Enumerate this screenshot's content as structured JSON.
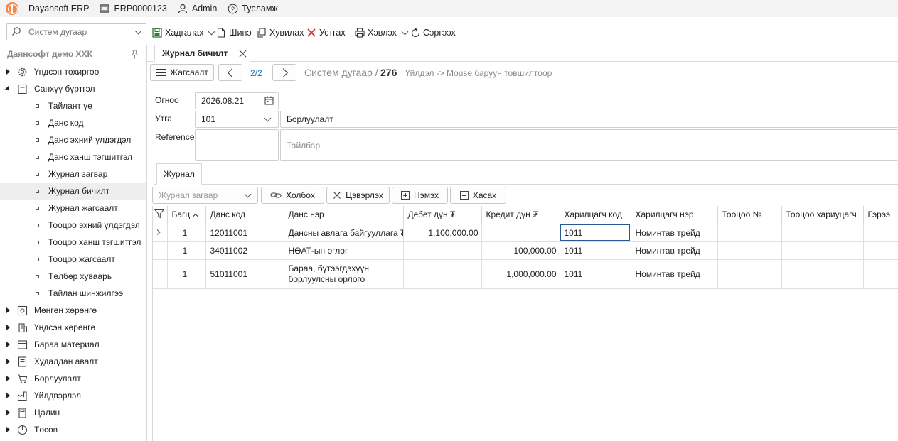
{
  "titlebar": {
    "app_name": "Dayansoft ERP",
    "db_name": "ERP0000123",
    "user": "Admin",
    "help": "Тусламж"
  },
  "toolbar": {
    "search_placeholder": "Систем дугаар",
    "save": "Хадгалах",
    "new": "Шинэ",
    "copy": "Хувилах",
    "delete": "Устгах",
    "print": "Хэвлэх",
    "refresh": "Сэргээх"
  },
  "sidebar": {
    "company": "Даянсофт демо ХХК",
    "items": [
      {
        "label": "Үндсэн тохиргоо",
        "icon": "gear-icon",
        "expanded": false
      },
      {
        "label": "Санхүү бүртгэл",
        "icon": "book-icon",
        "expanded": true
      }
    ],
    "subitems": [
      "Тайлант үе",
      "Данс код",
      "Данс эхний үлдэгдэл",
      "Данс ханш тэгшитгэл",
      "Журнал загвар",
      "Журнал бичилт",
      "Журнал жагсаалт",
      "Тооцоо эхний үлдэгдэл",
      "Тооцоо ханш тэгшитгэл",
      "Тооцоо жагсаалт",
      "Төлбөр хуваарь",
      "Тайлан шинжилгээ"
    ],
    "selected_subitem": "Журнал бичилт",
    "modules": [
      {
        "label": "Мөнгөн хөрөнгө",
        "icon": "safe-icon"
      },
      {
        "label": "Үндсэн хөрөнгө",
        "icon": "building-icon"
      },
      {
        "label": "Бараа материал",
        "icon": "box-icon"
      },
      {
        "label": "Худалдан авалт",
        "icon": "document-icon"
      },
      {
        "label": "Борлуулалт",
        "icon": "cart-icon"
      },
      {
        "label": "Үйлдвэрлэл",
        "icon": "factory-icon"
      },
      {
        "label": "Цалин",
        "icon": "calculator-icon"
      },
      {
        "label": "Төсөв",
        "icon": "pie-chart-icon"
      }
    ]
  },
  "document_tab": {
    "title": "Журнал бичилт"
  },
  "nav": {
    "list_button": "Жагсаалт",
    "page_indicator": "2/2",
    "system_number_label": "Систем дугаар /",
    "system_number": "276",
    "hint": "Үйлдэл -> Mouse баруун товшилтоор"
  },
  "form": {
    "date_label": "Огноо",
    "date_value": "2026.08.21",
    "code_label": "Утга",
    "code_value": "101",
    "code_description": "Борлуулалт",
    "reference_label": "Reference",
    "reference_value": "",
    "note_placeholder": "Тайлбар"
  },
  "subtabs": [
    "Журнал"
  ],
  "grid_toolbar": {
    "template_placeholder": "Журнал загвар",
    "link": "Холбох",
    "clear": "Цэвэрлэх",
    "add": "Нэмэх",
    "remove": "Хасах"
  },
  "grid": {
    "columns": [
      "Багц",
      "Данс код",
      "Данс нэр",
      "Дебет дүн ₮",
      "Кредит дүн ₮",
      "Харилцагч код",
      "Харилцагч нэр",
      "Тооцоо №",
      "Тооцоо хариуцагч",
      "Гэрээ"
    ],
    "rows": [
      {
        "batch": "1",
        "account_code": "12011001",
        "account_name": "Дансны авлага байгууллага ₮",
        "debit": "1,100,000.00",
        "credit": "",
        "partner_code": "1011",
        "partner_name": "Номинтав трейд",
        "settlement_no": "",
        "settlement_owner": "",
        "contract": ""
      },
      {
        "batch": "1",
        "account_code": "34011002",
        "account_name": "НӨАТ-ын өглөг",
        "debit": "",
        "credit": "100,000.00",
        "partner_code": "1011",
        "partner_name": "Номинтав трейд",
        "settlement_no": "",
        "settlement_owner": "",
        "contract": ""
      },
      {
        "batch": "1",
        "account_code": "51011001",
        "account_name": "Бараа, бүтээгдэхүүн борлуулсны орлого",
        "debit": "",
        "credit": "1,000,000.00",
        "partner_code": "1011",
        "partner_name": "Номинтав трейд",
        "settlement_no": "",
        "settlement_owner": "",
        "contract": ""
      }
    ]
  }
}
